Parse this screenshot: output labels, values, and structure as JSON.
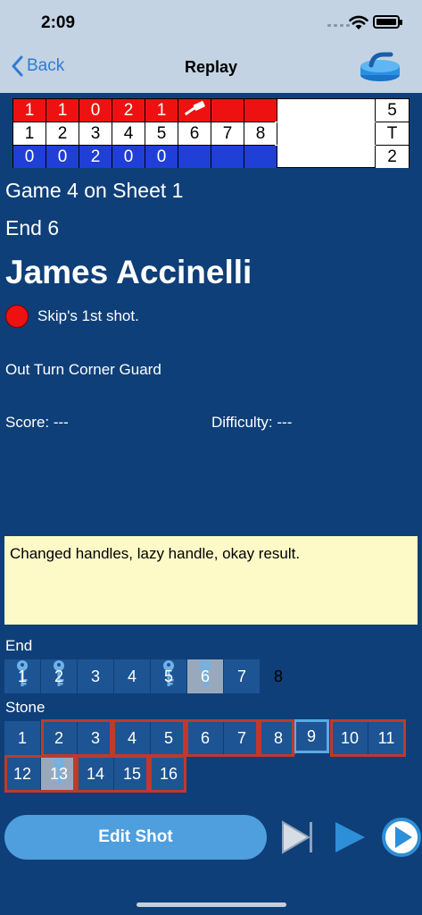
{
  "status": {
    "time": "2:09"
  },
  "nav": {
    "back_label": "Back",
    "title": "Replay"
  },
  "scoreboard": {
    "top_row": [
      "1",
      "1",
      "0",
      "2",
      "1"
    ],
    "ends": [
      "1",
      "2",
      "3",
      "4",
      "5",
      "6",
      "7",
      "8"
    ],
    "bottom_row": [
      "0",
      "0",
      "2",
      "0",
      "0"
    ],
    "totals": [
      "5",
      "T",
      "2"
    ],
    "top_color": "#ee1111",
    "bottom_color": "#1f3fd6"
  },
  "info": {
    "game": "Game 4 on Sheet 1",
    "end": "End 6",
    "player": "James Accinelli",
    "shot": "Skip's 1st shot.",
    "shot_type": "Out Turn Corner Guard",
    "score": "Score:  ---",
    "difficulty": "Difficulty:  ---"
  },
  "notes": "Changed handles, lazy handle, okay result.",
  "end_section": {
    "label": "End",
    "items": [
      "1",
      "2",
      "3",
      "4",
      "5",
      "6",
      "7",
      "8"
    ]
  },
  "stone_section": {
    "label": "Stone",
    "items": [
      "1",
      "2",
      "3",
      "4",
      "5",
      "6",
      "7",
      "8",
      "9",
      "10",
      "11",
      "12",
      "13",
      "14",
      "15",
      "16"
    ]
  },
  "actions": {
    "edit_label": "Edit Shot"
  },
  "icons": {
    "back": "chevron-left-icon",
    "app": "curling-stone-icon",
    "hammer": "hammer-icon",
    "key": "key-icon",
    "step": "step-forward-icon",
    "play": "play-icon",
    "next": "next-circle-icon"
  }
}
